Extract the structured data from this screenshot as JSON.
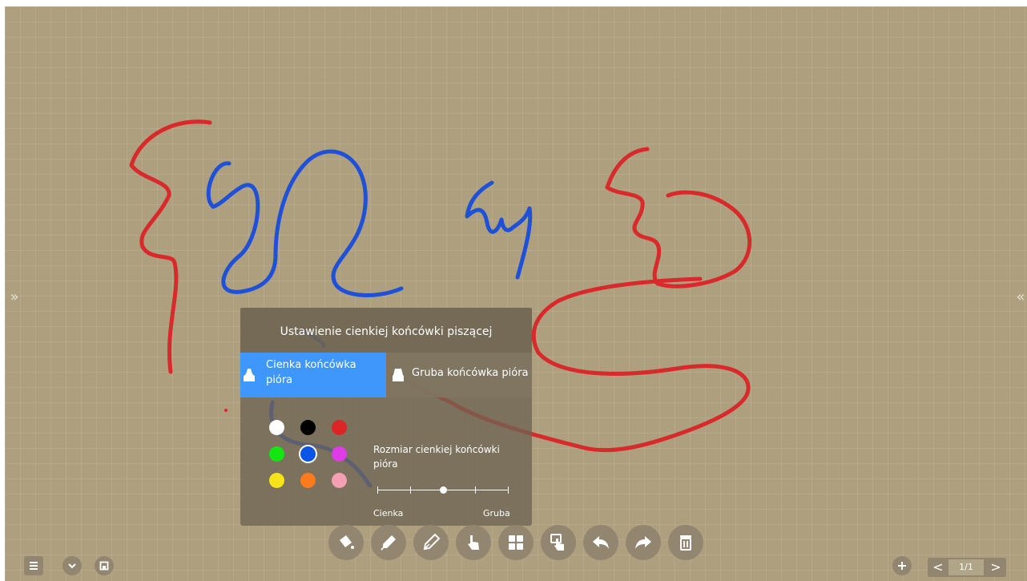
{
  "sidebar": {
    "left_toggle": "»",
    "right_toggle": "«"
  },
  "pen_panel": {
    "title": "Ustawienie cienkiej końcówki piszącej",
    "tabs": [
      {
        "label": "Cienka końcówka pióra",
        "active": true
      },
      {
        "label": "Gruba końcówka pióra",
        "active": false
      }
    ],
    "colors": [
      [
        "#ffffff",
        "#000000",
        "#dd2525"
      ],
      [
        "#14e614",
        "#0c54e6",
        "#dd3ce6"
      ],
      [
        "#f6e31a",
        "#ff7a1a",
        "#f59fb4"
      ]
    ],
    "selected_color": "#0c54e6",
    "size_label": "Rozmiar cienkiej końcówki pióra",
    "size_min_label": "Cienka",
    "size_max_label": "Gruba",
    "size_steps": 5,
    "size_level": 3
  },
  "toolbar": {
    "tools": [
      "fill-bucket-icon",
      "marker-icon",
      "fountain-pen-icon",
      "pointer-hand-icon",
      "grid-icon",
      "touch-icon",
      "undo-icon",
      "redo-icon",
      "trash-icon"
    ],
    "active_tool": "fountain-pen-icon"
  },
  "pager": {
    "prev": "<",
    "next": ">",
    "page_label": "1/1"
  },
  "stroke_colors": {
    "red": "#d8292b",
    "blue": "#1e51d8"
  }
}
